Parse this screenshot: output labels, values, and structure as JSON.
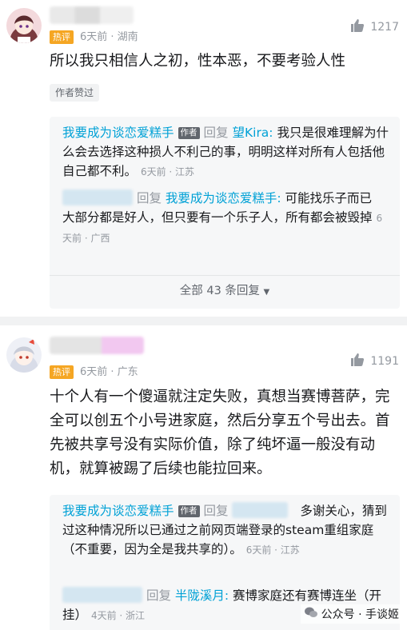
{
  "comments": [
    {
      "hot_label": "热评",
      "meta": "6天前 · 湖南",
      "likes": "1217",
      "content": "所以我只相信人之初，性本恶，不要考验人性",
      "author_liked": "作者赞过",
      "replies": [
        {
          "user": "我要成为谈恋爱糕手",
          "author_tag": "作者",
          "reply_word": "回复",
          "target": "望Kira:",
          "text": " 我只是很难理解为什么会去选择这种损人不利己的事，明明这样对所有人包括他自己都不利。",
          "meta": "6天前 · 江苏"
        },
        {
          "reply_word": "回复",
          "target": "我要成为谈恋爱糕手:",
          "text": " 可能找乐子而已",
          "text2": "大部分都是好人，但只要有一个乐子人，所有都会被毁掉",
          "meta": "6天前 · 广西"
        }
      ],
      "more": "全部 43 条回复"
    },
    {
      "hot_label": "热评",
      "meta": "6天前 · 广东",
      "likes": "1191",
      "content": "十个人有一个傻逼就注定失败，真想当赛博菩萨，完全可以创五个小号进家庭，然后分享五个号出去。首先被共享号没有实际价值，除了纯坏逼一般没有动机，就算被踢了后续也能拉回来。",
      "replies": [
        {
          "user": "我要成为谈恋爱糕手",
          "author_tag": "作者",
          "reply_word": "回复",
          "text_a": "多谢关",
          "text_b": "心，猜到过这种情况所以已通过之前网页端登录的steam重组家庭（不重要，因为全是我共享的）。",
          "meta": "6天前 · 江苏"
        },
        {
          "reply_word": "回复",
          "target": "半陇溪月:",
          "text": " 赛博家庭还有赛博连坐（开挂）",
          "meta": "4天前 · 浙江"
        }
      ]
    }
  ],
  "watermark": "公众号 · 手谈姬",
  "colors": {
    "link_blue": "#00a1d6",
    "hot_orange": "#f5a623",
    "meta_grey": "#9499a0"
  }
}
